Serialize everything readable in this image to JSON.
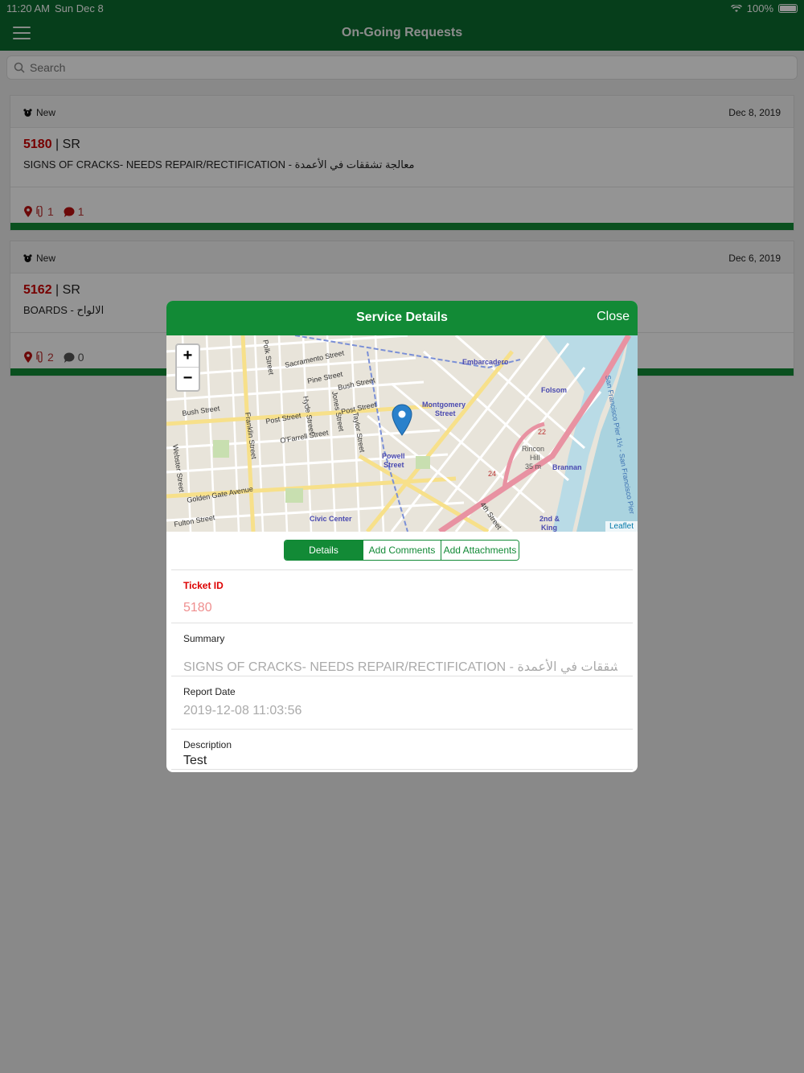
{
  "status_bar": {
    "time": "11:20 AM",
    "date": "Sun Dec 8",
    "battery": "100%"
  },
  "header": {
    "title": "On-Going Requests",
    "menu_icon": "hamburger-menu-icon"
  },
  "search": {
    "placeholder": "Search"
  },
  "requests": [
    {
      "status": "New",
      "date": "Dec 8, 2019",
      "id": "5180",
      "type": "| SR",
      "summary": "SIGNS OF CRACKS- NEEDS REPAIR/RECTIFICATION - معالجة تشققات في الأعمدة",
      "attachments": "1",
      "comments": "1"
    },
    {
      "status": "New",
      "date": "Dec 6, 2019",
      "id": "5162",
      "type": "| SR",
      "summary": "BOARDS - الالواح",
      "attachments": "2",
      "comments": "0"
    }
  ],
  "modal": {
    "title": "Service Details",
    "close_label": "Close",
    "map": {
      "zoom_in": "+",
      "zoom_out": "−",
      "attribution": "Leaflet",
      "labels": {
        "sacramento": "Sacramento Street",
        "pine": "Pine Street",
        "bush1": "Bush Street",
        "bush2": "Bush Street",
        "post1": "Post Street",
        "post2": "Post Street",
        "ofarrell": "O'Farrell Street",
        "golden": "Golden Gate Avenue",
        "fulton": "Fulton Street",
        "civic": "Civic Center",
        "powell": "Powell",
        "powell2": "Street",
        "montgomery": "Montgomery",
        "montgomery2": "Street",
        "embarcadero": "Embarcadero",
        "folsom": "Folsom",
        "rincon": "Rincon",
        "rincon2": "Hill",
        "rincon3": "35 m",
        "brannan": "Brannan",
        "king": "2nd &",
        "king2": "King",
        "polk": "Polk Street",
        "hyde": "Hyde Street",
        "jones": "Jones Street",
        "taylor": "Taylor Street",
        "franklin": "Franklin Street",
        "webster": "Webster Street",
        "fourth": "4th Street",
        "pier": "San Francisco Pier 1½ - San Francisco Pier",
        "r22": "22",
        "r24": "24"
      }
    },
    "tabs": [
      "Details",
      "Add Comments",
      "Add Attachments"
    ],
    "fields": {
      "ticket_label": "Ticket ID",
      "ticket_value": "5180",
      "summary_label": "Summary",
      "summary_value": "SIGNS OF CRACKS- NEEDS REPAIR/RECTIFICATION - تشققات في الأعمدة",
      "report_label": "Report Date",
      "report_value": "2019-12-08 11:03:56",
      "desc_label": "Description",
      "desc_value": "Test"
    }
  },
  "colors": {
    "header_green": "#0b6b2f",
    "accent_green": "#128a36",
    "id_red": "#cc0000"
  }
}
